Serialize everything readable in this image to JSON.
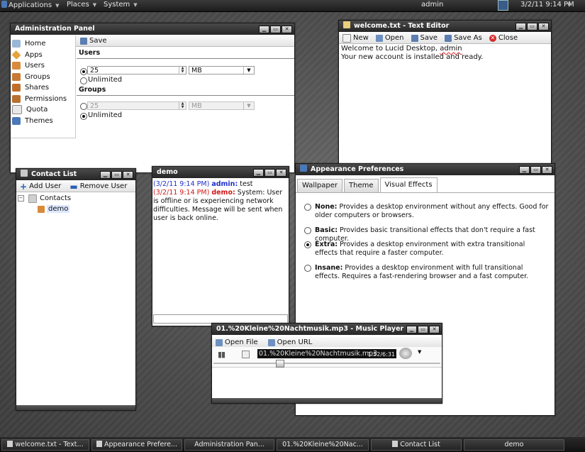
{
  "top_panel": {
    "menus": [
      "Applications",
      "Places",
      "System"
    ],
    "user": "admin",
    "clock": "3/2/11 9:14 PM"
  },
  "admin_panel": {
    "title": "Administration Panel",
    "save": "Save",
    "nav": [
      "Home",
      "Apps",
      "Users",
      "Groups",
      "Shares",
      "Permissions",
      "Quota",
      "Themes"
    ],
    "users_heading": "Users",
    "users_value": "25",
    "users_unit": "MB",
    "users_unlimited": "Unlimited",
    "groups_heading": "Groups",
    "groups_value": "25",
    "groups_unit": "MB",
    "groups_unlimited": "Unlimited"
  },
  "text_editor": {
    "title": "welcome.txt - Text Editor",
    "buttons": {
      "new": "New",
      "open": "Open",
      "save": "Save",
      "save_as": "Save As",
      "close": "Close"
    },
    "line1_prefix": "Welcome to Lucid Desktop, ",
    "line1_user": "admin",
    "line2": "Your new account is installed and ready."
  },
  "contact_list": {
    "title": "Contact List",
    "add_user": "Add User",
    "remove_user": "Remove User",
    "group": "Contacts",
    "contact": "demo"
  },
  "chat": {
    "title": "demo",
    "msg1_time": "(3/2/11 9:14 PM) ",
    "msg1_user": "admin:",
    "msg1_text": " test",
    "msg2_time": "(3/2/11 9:14 PM) ",
    "msg2_user": "demo:",
    "msg2_text": " System: User is offline or is experiencing network difficulties. Message will be sent when user is back online."
  },
  "appearance": {
    "title": "Appearance Preferences",
    "tabs": [
      "Wallpaper",
      "Theme",
      "Visual Effects"
    ],
    "options": [
      {
        "name": "None:",
        "desc": " Provides a desktop environment without any effects. Good for older computers or browsers."
      },
      {
        "name": "Basic:",
        "desc": " Provides basic transitional effects that don't require a fast computer."
      },
      {
        "name": "Extra:",
        "desc": " Provides a desktop environment with extra transitional effects that require a faster computer."
      },
      {
        "name": "Insane:",
        "desc": " Provides a desktop environment with full transitional effects. Requires a fast-rendering browser and a fast computer."
      }
    ],
    "selected_index": 2
  },
  "music_player": {
    "title": "01.%20Kleine%20Nachtmusik.mp3 - Music Player",
    "open_file": "Open File",
    "open_url": "Open URL",
    "track": "01.%20Kleine%20Nachtmusik.mp3",
    "time": "1:52/6:31"
  },
  "taskbar": {
    "items": [
      "welcome.txt - Text...",
      "Appearance Prefere...",
      "Administration Pan...",
      "01.%20Kleine%20Nac...",
      "Contact List",
      "demo"
    ]
  }
}
